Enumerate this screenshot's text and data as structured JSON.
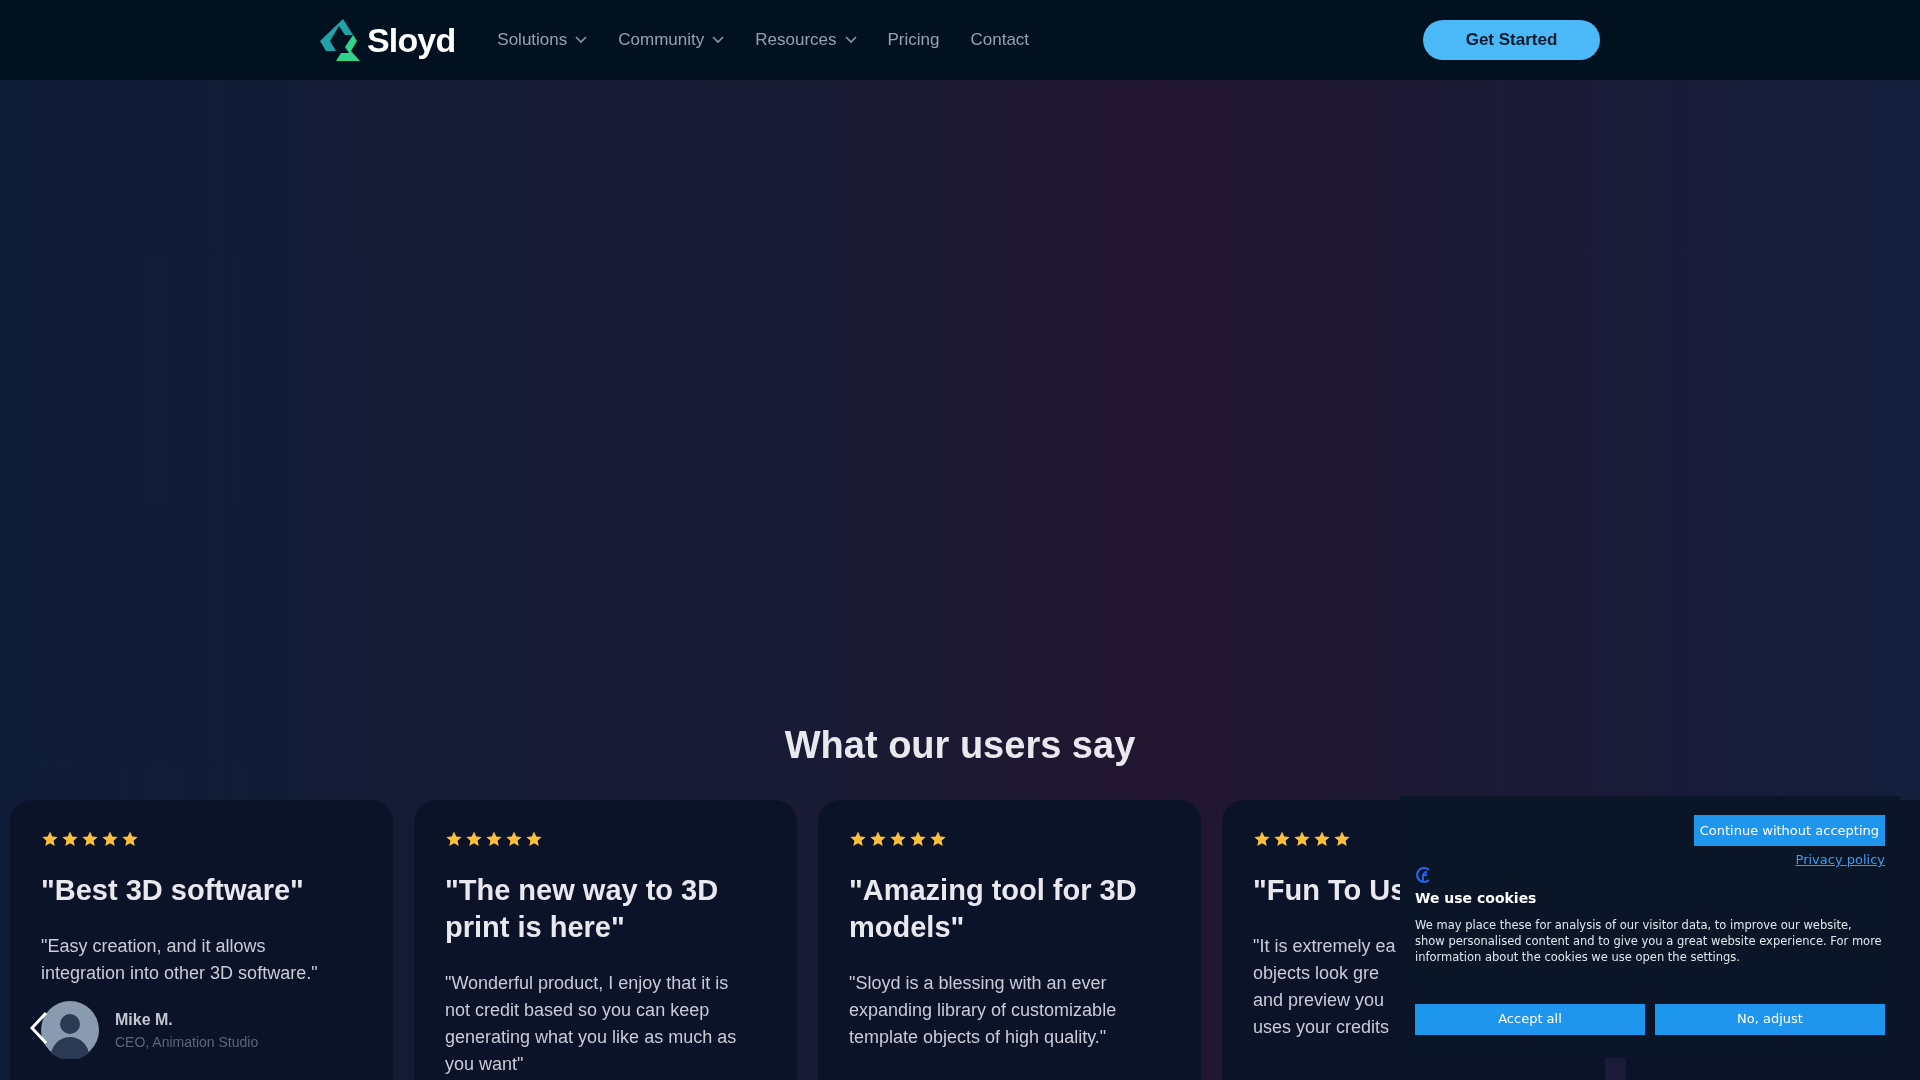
{
  "nav": {
    "brand": "Sloyd",
    "links": [
      {
        "label": "Solutions",
        "dropdown": true
      },
      {
        "label": "Community",
        "dropdown": true
      },
      {
        "label": "Resources",
        "dropdown": true
      },
      {
        "label": "Pricing",
        "dropdown": false
      },
      {
        "label": "Contact",
        "dropdown": false
      }
    ],
    "cta": "Get Started"
  },
  "testimonials": {
    "heading": "What our users say",
    "cards": [
      {
        "stars": 5,
        "title": "\"Best 3D software\"",
        "quote_lines": [
          "\"Easy creation, and it allows integration into other 3D software.\""
        ],
        "author": {
          "name": "Mike M.",
          "role": "CEO, Animation Studio"
        }
      },
      {
        "stars": 5,
        "title": "\"The new way to 3D print is here\"",
        "quote_lines": [
          "\"Wonderful product, I enjoy that it is not credit based so you can keep generating what you like as much as you want\""
        ]
      },
      {
        "stars": 5,
        "title": "\"Amazing tool for 3D models\"",
        "quote_lines": [
          "\"Sloyd is a blessing with an ever expanding library of customizable template objects of high quality.\""
        ]
      },
      {
        "stars": 5,
        "title": "\"Fun To Us",
        "quote_lines": [
          "\"It is extremely ea",
          "objects look gre",
          "and preview you",
          "uses your credits"
        ]
      }
    ]
  },
  "cookie_banner": {
    "continue_button": "Continue without accepting",
    "privacy_link": "Privacy policy",
    "title": "We use cookies",
    "text": "We may place these for analysis of our visitor data, to improve our website, show personalised content and to give you a great website experience. For more information about the cookies we use open the settings.",
    "buttons": [
      "Accept all",
      "No, adjust"
    ]
  }
}
